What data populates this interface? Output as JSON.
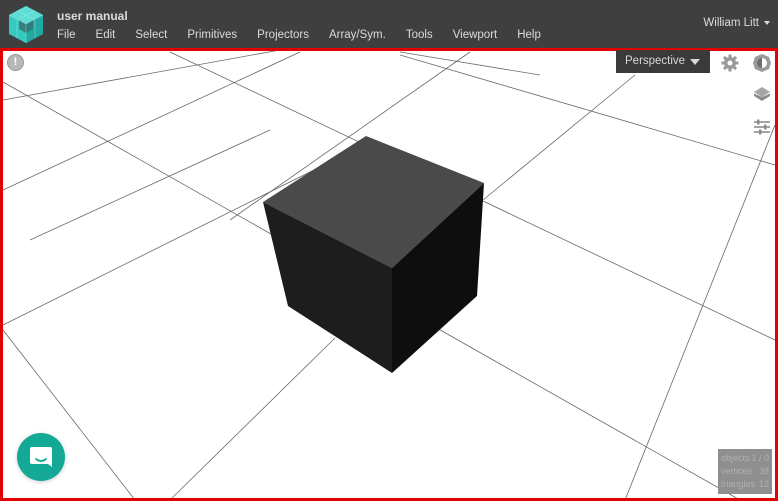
{
  "app": {
    "document_title": "user manual",
    "logo_icon": "m-cube-logo-icon"
  },
  "menu": {
    "items": [
      "File",
      "Edit",
      "Select",
      "Primitives",
      "Projectors",
      "Array/Sym.",
      "Tools",
      "Viewport",
      "Help"
    ]
  },
  "user": {
    "name": "William Litt",
    "dropdown_icon": "caret-down-icon"
  },
  "viewport": {
    "camera_mode": "Perspective",
    "icons": {
      "info": "info-icon",
      "settings": "gear-icon",
      "display": "contrast-icon",
      "layers": "layers-icon",
      "adjust": "sliders-icon",
      "chat": "chat-icon"
    },
    "scene_object": "cube",
    "accent_color": "#e30000",
    "chat_color": "#14a896"
  },
  "stats": {
    "objects_label": "objects",
    "objects_value": "1 / 0",
    "vertices_label": "vertices",
    "vertices_value": "38",
    "triangles_label": "triangles",
    "triangles_value": "12"
  }
}
